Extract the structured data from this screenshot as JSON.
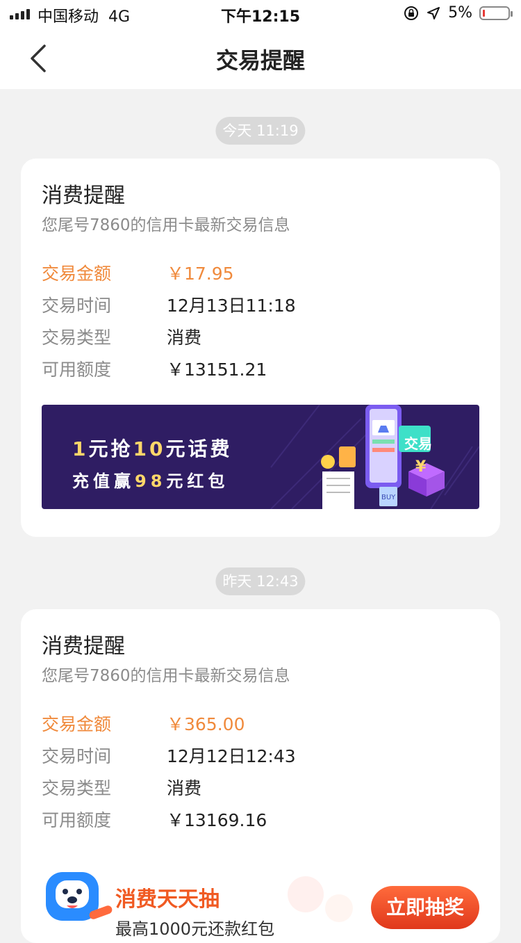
{
  "status_bar": {
    "carrier": "中国移动",
    "network": "4G",
    "time": "下午12:15",
    "battery_percent": "5%"
  },
  "nav": {
    "title": "交易提醒"
  },
  "messages": [
    {
      "time_chip": "今天 11:19",
      "title": "消费提醒",
      "subtitle": "您尾号7860的信用卡最新交易信息",
      "rows": [
        {
          "label": "交易金额",
          "value": "￥17.95"
        },
        {
          "label": "交易时间",
          "value": "12月13日11:18"
        },
        {
          "label": "交易类型",
          "value": "消费"
        },
        {
          "label": "可用额度",
          "value": "￥13151.21"
        }
      ],
      "banner": {
        "line1_a": "1",
        "line1_b": "元抢",
        "line1_c": "10",
        "line1_d": "元话费",
        "line2_a": "充值赢",
        "line2_b": "98",
        "line2_c": "元红包",
        "badge": "交易",
        "buy_tag": "BUY"
      }
    },
    {
      "time_chip": "昨天 12:43",
      "title": "消费提醒",
      "subtitle": "您尾号7860的信用卡最新交易信息",
      "rows": [
        {
          "label": "交易金额",
          "value": "￥365.00"
        },
        {
          "label": "交易时间",
          "value": "12月12日12:43"
        },
        {
          "label": "交易类型",
          "value": "消费"
        },
        {
          "label": "可用额度",
          "value": "￥13169.16"
        }
      ],
      "promo": {
        "title": "消费天天抽",
        "subtitle": "最高1000元还款红包",
        "button": "立即抽奖"
      }
    }
  ],
  "colors": {
    "accent_orange": "#f08a3c",
    "banner_purple": "#2f1d63",
    "promo_red": "#e0381b"
  }
}
